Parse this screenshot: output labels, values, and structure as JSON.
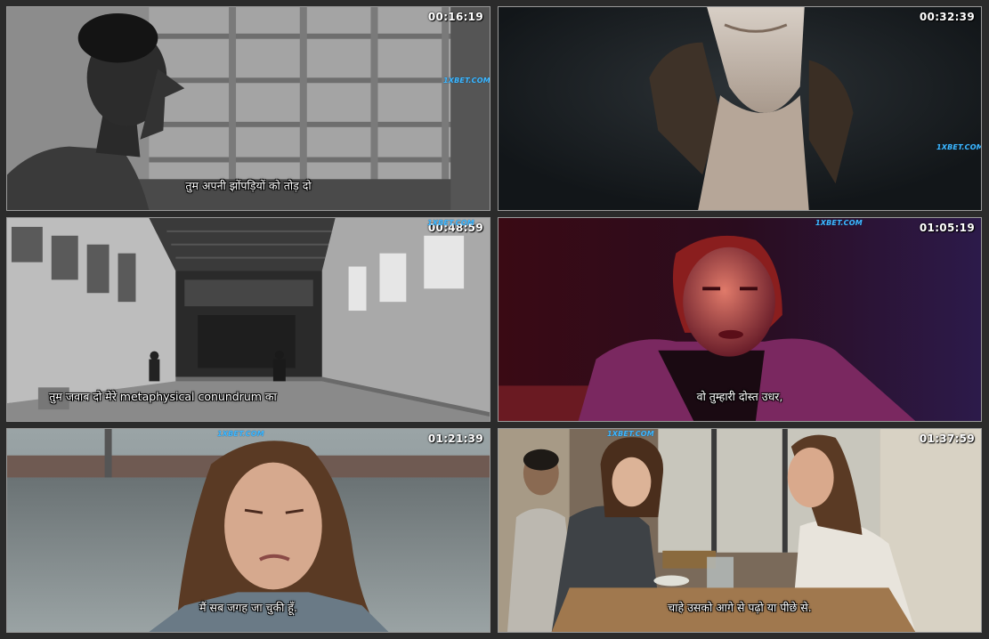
{
  "frames": [
    {
      "timestamp": "00:16:19",
      "watermark": "1XBET.COM",
      "subtitle": "तुम अपनी झोंपड़ियों को तोड़ दो"
    },
    {
      "timestamp": "00:32:39",
      "watermark": "1XBET.COM",
      "subtitle": ""
    },
    {
      "timestamp": "00:48:59",
      "watermark": "1XBET.COM",
      "subtitle": "तुम जवाब दो मेरे metaphysical conundrum का"
    },
    {
      "timestamp": "01:05:19",
      "watermark": "1XBET.COM",
      "subtitle": "वो तुम्हारी दोस्त उधर,"
    },
    {
      "timestamp": "01:21:39",
      "watermark": "1XBET.COM",
      "subtitle": "मैं सब जगह जा चुकी हूँ."
    },
    {
      "timestamp": "01:37:59",
      "watermark": "1XBET.COM",
      "subtitle": "चाहे उसको आगे से पढ़ो या पीछे से."
    }
  ]
}
